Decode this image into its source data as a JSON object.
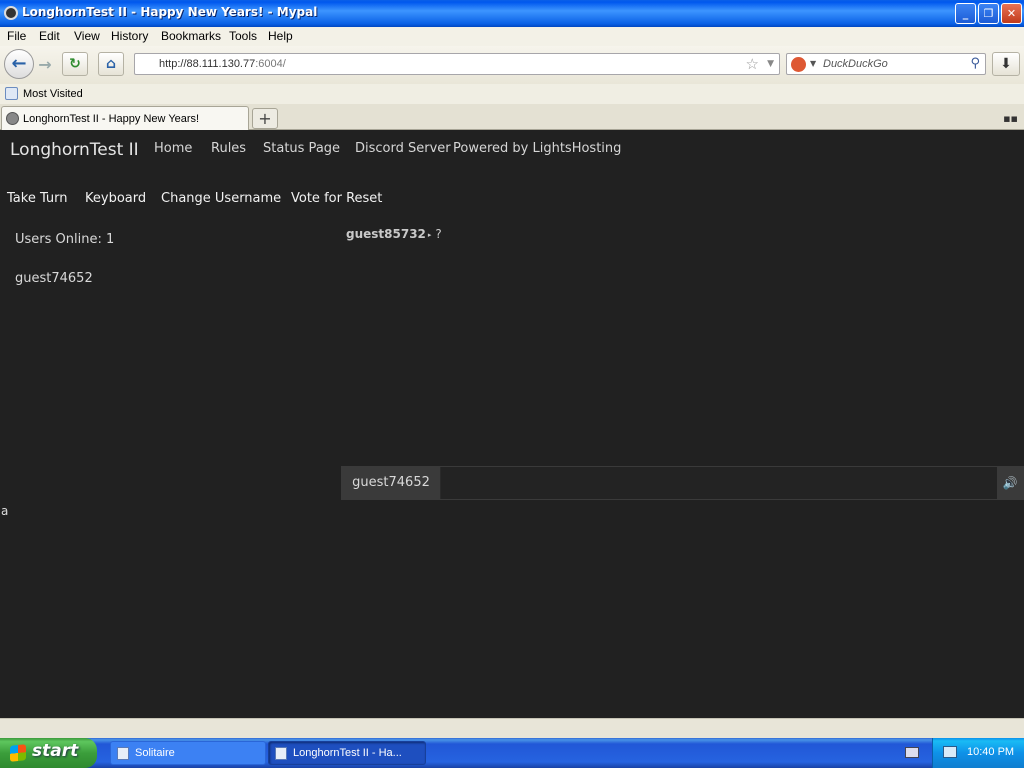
{
  "window": {
    "title": "LonghornTest II - Happy New Years! - Mypal",
    "minimize_glyph": "_",
    "restore_glyph": "❐",
    "close_glyph": "✕"
  },
  "menu": {
    "items": [
      "File",
      "Edit",
      "View",
      "History",
      "Bookmarks",
      "Tools",
      "Help"
    ]
  },
  "toolbar": {
    "back_glyph": "←",
    "forward_glyph": "→",
    "reload_glyph": "↻",
    "home_glyph": "⌂",
    "url_host": "http://88.111.130.77",
    "url_port": ":6004/",
    "star_glyph": "☆",
    "dropdown_glyph": "▼",
    "search_engine": "DuckDuckGo",
    "search_glyph": "⚲",
    "download_glyph": "⬇"
  },
  "bookmarks": {
    "most_visited": "Most Visited"
  },
  "tabs": {
    "active_title": "LonghornTest II - Happy New Years!",
    "new_tab_glyph": "+",
    "list_glyph": "▪▪"
  },
  "site": {
    "brand": "LonghornTest II",
    "nav": [
      "Home",
      "Rules",
      "Status Page",
      "Discord Server",
      "Powered by LightsHosting"
    ],
    "actions": [
      "Take Turn",
      "Keyboard",
      "Change Username",
      "Vote for Reset"
    ],
    "users_online": "Users Online: 1",
    "users": [
      "guest74652"
    ],
    "chat": {
      "message_user": "guest85732",
      "message_arrow": "▸",
      "message_text": "?",
      "stray_text": "a",
      "input_username": "guest74652",
      "input_value": "",
      "sound_glyph": "🔊"
    }
  },
  "taskbar": {
    "start_label": "start",
    "items": [
      "Solitaire",
      "LonghornTest II - Ha..."
    ],
    "clock": "10:40 PM"
  }
}
